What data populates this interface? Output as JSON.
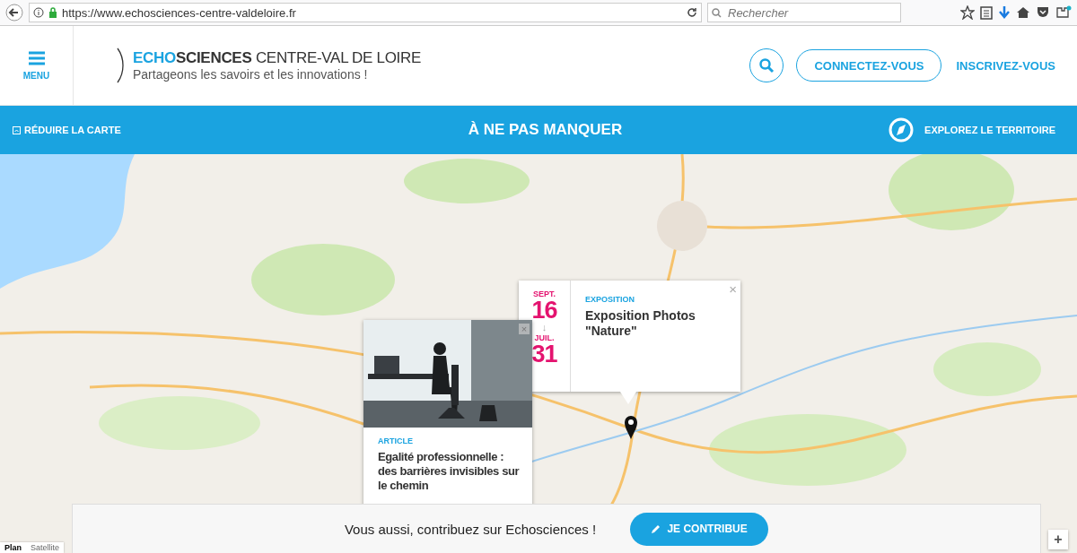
{
  "browser": {
    "url": "https://www.echosciences-centre-valdeloire.fr",
    "search_placeholder": "Rechercher"
  },
  "header": {
    "menu_label": "MENU",
    "logo": {
      "part_1": "ECHO",
      "part_2": "SCIENCES",
      "part_3": "CENTRE-VAL DE LOIRE"
    },
    "tagline": "Partageons les savoirs et les innovations !",
    "login_button": "CONNECTEZ-VOUS",
    "signup_link": "INSCRIVEZ-VOUS"
  },
  "banner": {
    "collapse_link": "RÉDUIRE LA CARTE",
    "title": "À NE PAS MANQUER",
    "explore_link": "EXPLOREZ LE TERRITOIRE"
  },
  "map": {
    "type_tabs": [
      {
        "label": "Plan",
        "selected": true
      },
      {
        "label": "Satellite",
        "selected": false
      }
    ],
    "zoom_in": "+"
  },
  "event_popup": {
    "start_month": "SEPT.",
    "start_day": "16",
    "arrow": "↓",
    "end_month": "JUIL.",
    "end_day": "31",
    "category": "EXPOSITION",
    "title": "Exposition Photos \"Nature\"",
    "close": "×"
  },
  "article_card": {
    "category": "ARTICLE",
    "title": "Egalité professionnelle : des barrières invisibles sur le chemin",
    "close": "×"
  },
  "contribute_bar": {
    "text": "Vous aussi, contribuez sur Echosciences !",
    "button": "JE CONTRIBUE"
  }
}
